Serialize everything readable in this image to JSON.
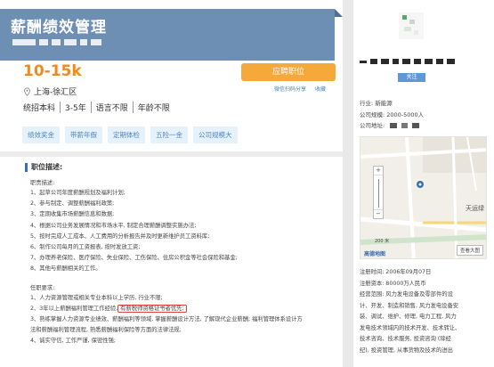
{
  "job": {
    "title": "薪酬绩效管理",
    "salary": "10-15k",
    "apply_label": "应聘职位",
    "share_label": "微信扫码分享",
    "favorite_label": "收藏",
    "location": "上海-徐汇区",
    "requirements": [
      "统招本科",
      "3-5年",
      "语言不限",
      "年龄不限"
    ],
    "tags": [
      "绩效奖金",
      "带薪年假",
      "定期体检",
      "五险一金",
      "公司规模大"
    ]
  },
  "description": {
    "heading": "职位描述:",
    "duties_label": "职责描述:",
    "duties": [
      "1、起草公司年度薪酬规划及福利计划;",
      "2、参与制定、调整薪酬福利政策;",
      "3、定期收集市场薪酬信息和数据;",
      "4、根据公司业务发展情况和市场水平, 制定合理薪酬调整实施办法;",
      "5、按时完成人工成本、人工费用的分析报告并及时更新维护员工资料库;",
      "6、制作公司每月的工资报表, 按时发放工资;",
      "7、办理养老保险、医疗保险、失业保险、工伤保险、住房公积金等社会保险和基金;",
      "8、其他与薪酬相关的工作。"
    ],
    "req_label": "任职要求:",
    "req1": "1、人力资源管理或相关专业本科以上学历, 行业不限;",
    "req2_prefix": "2、3年以上薪酬福利管理工作经验,",
    "req2_highlight": "有薪税师资格证书者优先;",
    "req3a": "3、熟练掌握人力资源专业绩效、薪酬福利等领域, 掌握薪酬设计方法, 了解现代企业薪酬; 福利管理体系设计方",
    "req3b": "法和薪酬福利管理流程, 熟悉薪酬福利保险等方面的法律法规;",
    "req4": "4、诚实守信, 工作严谨, 保密性强;"
  },
  "company": {
    "follow_label": "关注",
    "industry": "行业: 新能源",
    "size": "公司规模: 2000-5000人",
    "address_label": "公司地址:",
    "registered": "注册时间: 2006年09月07日",
    "capital": "注册资本: 80000万人民币",
    "scope": [
      "经营范围: 风力发电设备及零部件的设",
      "计、开发、制造和销售, 风力发电设备安",
      "装、调试、维护、修理, 电力工程, 风力",
      "发电技术领域内的技术开发、技术转让、",
      "技术咨询、技术服务, 投资咨询 (除经",
      "纪), 投资管理, 从事货物及技术的进出"
    ]
  },
  "map": {
    "zoom_in": "+",
    "zoom_out": "−",
    "scale_label": "200 米",
    "brand": "高德地图",
    "view_larger": "查看大图",
    "place_label": "天运绿"
  },
  "colors": {
    "banner": "#6d8fb4",
    "salary": "#f08b1b",
    "apply": "#f5a93b",
    "tag_bg": "#e6f2fb",
    "tag_text": "#4d86c0",
    "highlight_border": "#d94242"
  },
  "icons": [
    "location-pin-icon",
    "map-marker-icon"
  ]
}
